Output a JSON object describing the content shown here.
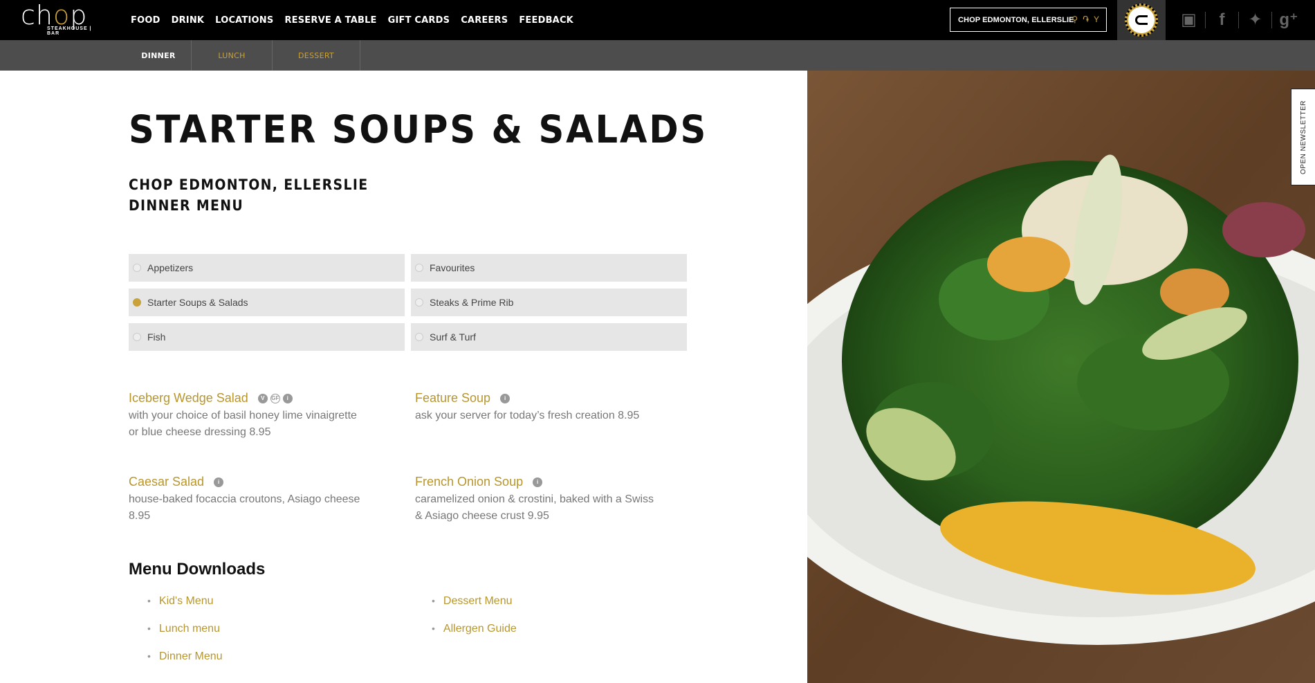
{
  "brand": {
    "name_part1": "ch",
    "name_o": "o",
    "name_part2": "p",
    "tagline": "STEAKHOUSE | BAR"
  },
  "nav": {
    "items": [
      "FOOD",
      "DRINK",
      "LOCATIONS",
      "RESERVE A TABLE",
      "GIFT CARDS",
      "CAREERS",
      "FEEDBACK"
    ]
  },
  "location": {
    "label": "CHOP EDMONTON, ELLERSLIE"
  },
  "icons": {
    "pin": "map-pin-icon",
    "fork": "utensils-icon",
    "glass": "cocktail-icon",
    "social": [
      "instagram-icon",
      "facebook-icon",
      "twitter-icon",
      "google-plus-icon"
    ]
  },
  "colors": {
    "accent": "#c9a23a",
    "topbar": "#000000",
    "subbar": "#4d4d4d",
    "item_name": "#b8962e"
  },
  "subnav": {
    "tabs": [
      {
        "label": "DINNER",
        "active": true
      },
      {
        "label": "LUNCH",
        "active": false
      },
      {
        "label": "DESSERT",
        "active": false
      }
    ]
  },
  "page": {
    "title": "STARTER SOUPS & SALADS",
    "subtitle_line1": "CHOP EDMONTON, ELLERSLIE",
    "subtitle_line2": "DINNER MENU"
  },
  "categories": [
    {
      "label": "Appetizers",
      "selected": false
    },
    {
      "label": "Favourites",
      "selected": false
    },
    {
      "label": "Starter Soups & Salads",
      "selected": true
    },
    {
      "label": "Steaks & Prime Rib",
      "selected": false
    },
    {
      "label": "Fish",
      "selected": false
    },
    {
      "label": "Surf & Turf",
      "selected": false
    }
  ],
  "menu_items": [
    {
      "name": "Iceberg Wedge Salad",
      "badges": [
        "V",
        "GF",
        "i"
      ],
      "desc_line1": "with your choice of basil honey lime vinaigrette",
      "desc_line2": "or blue cheese dressing 8.95"
    },
    {
      "name": "Feature Soup",
      "badges": [
        "i"
      ],
      "desc_line1": "ask your server for today’s fresh creation 8.95",
      "desc_line2": ""
    },
    {
      "name": "Caesar Salad",
      "badges": [
        "i"
      ],
      "desc_line1": "house-baked focaccia croutons, Asiago cheese",
      "desc_line2": "8.95"
    },
    {
      "name": "French Onion Soup",
      "badges": [
        "i"
      ],
      "desc_line1": "caramelized onion & crostini, baked with a Swiss",
      "desc_line2": "& Asiago cheese crust 9.95"
    }
  ],
  "downloads": {
    "title": "Menu Downloads",
    "col1": [
      "Kid's Menu",
      "Lunch menu",
      "Dinner Menu"
    ],
    "col2": [
      "Dessert Menu",
      "Allergen Guide"
    ]
  },
  "newsletter": {
    "label": "OPEN NEWSLETTER"
  }
}
